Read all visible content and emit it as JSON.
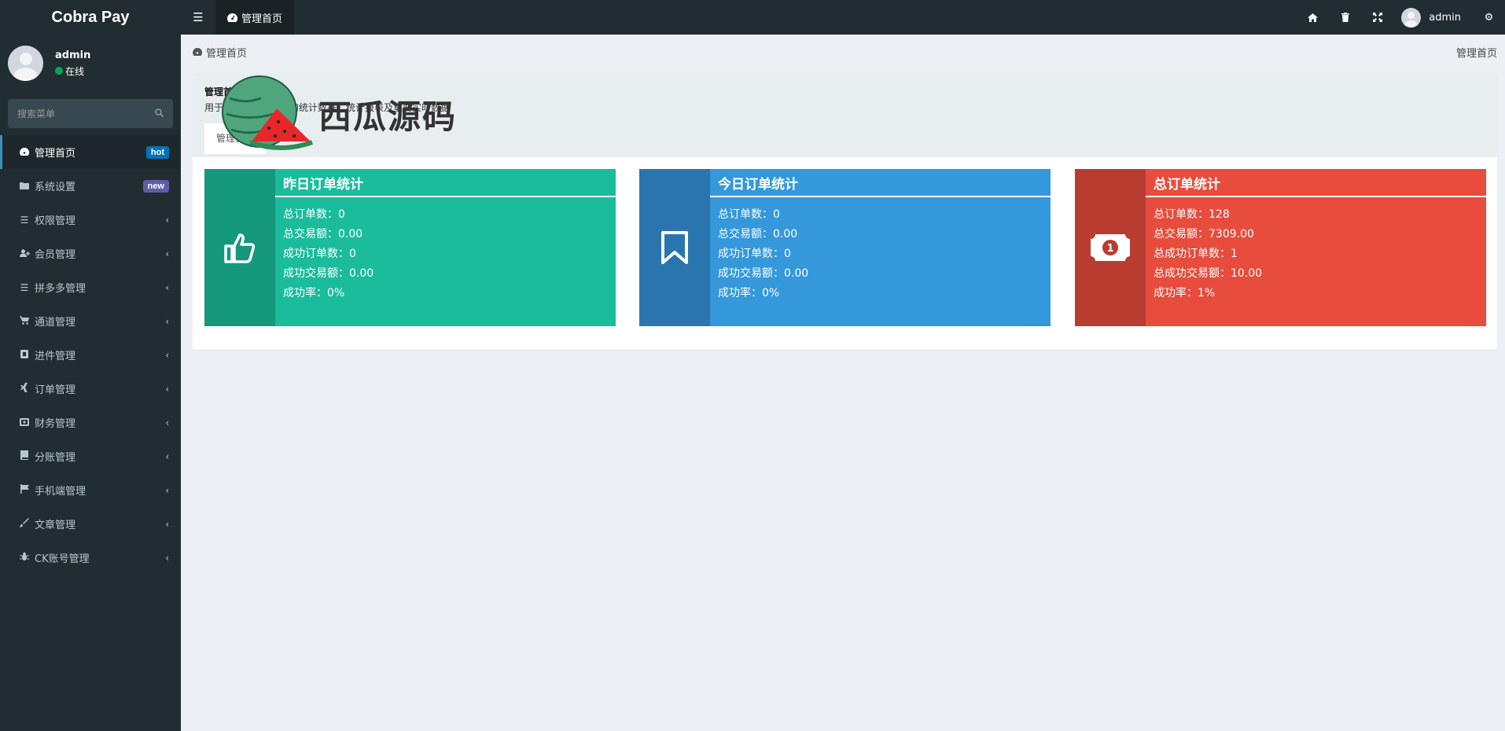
{
  "app": {
    "title": "Cobra Pay"
  },
  "navbar": {
    "toggle_icon": "bars-icon",
    "tab": {
      "icon": "dashboard-icon",
      "label": "管理首页"
    },
    "icons": [
      "home-icon",
      "trash-icon",
      "expand-icon"
    ],
    "user": {
      "name": "admin"
    },
    "settings_icon": "gears-icon"
  },
  "sidebar": {
    "user": {
      "name": "admin",
      "status": "在线"
    },
    "search": {
      "placeholder": "搜索菜单"
    },
    "items": [
      {
        "label": "管理首页",
        "icon": "dashboard-icon",
        "badge": "hot",
        "active": true
      },
      {
        "label": "系统设置",
        "icon": "folder-icon",
        "badge": "new"
      },
      {
        "label": "权限管理",
        "icon": "list-icon"
      },
      {
        "label": "会员管理",
        "icon": "user-plus-icon"
      },
      {
        "label": "拼多多管理",
        "icon": "list-icon"
      },
      {
        "label": "通道管理",
        "icon": "cart-icon"
      },
      {
        "label": "进件管理",
        "icon": "box-icon"
      },
      {
        "label": "订单管理",
        "icon": "xing-icon"
      },
      {
        "label": "财务管理",
        "icon": "wallet-icon"
      },
      {
        "label": "分账管理",
        "icon": "book-icon"
      },
      {
        "label": "手机端管理",
        "icon": "flag-icon"
      },
      {
        "label": "文章管理",
        "icon": "paint-brush-icon"
      },
      {
        "label": "CK账号管理",
        "icon": "bug-icon"
      }
    ]
  },
  "breadcrumb": {
    "left": "管理首页",
    "right": "管理首页"
  },
  "panel": {
    "title": "管理首页",
    "description": "用于展示当前系统中的统计数据、统计报表及重要实时数据",
    "tab": "管理首页"
  },
  "watermark": {
    "text": "西瓜源码"
  },
  "stats": [
    {
      "title": "昨日订单统计",
      "icon": "thumbs-up-icon",
      "color": "#1abc9c",
      "lines": [
        {
          "label": "总订单数：",
          "value": "0"
        },
        {
          "label": "总交易额：",
          "value": "0.00"
        },
        {
          "label": "成功订单数：",
          "value": "0"
        },
        {
          "label": "成功交易额：",
          "value": "0.00"
        },
        {
          "label": "成功率：",
          "value": "0%"
        }
      ]
    },
    {
      "title": "今日订单统计",
      "icon": "bookmark-icon",
      "color": "#3498db",
      "lines": [
        {
          "label": "总订单数：",
          "value": "0"
        },
        {
          "label": "总交易额：",
          "value": "0.00"
        },
        {
          "label": "成功订单数：",
          "value": "0"
        },
        {
          "label": "成功交易额：",
          "value": "0.00"
        },
        {
          "label": "成功率：",
          "value": "0%"
        }
      ]
    },
    {
      "title": "总订单统计",
      "icon": "money-icon",
      "color": "#e74c3c",
      "lines": [
        {
          "label": "总订单数：",
          "value": "128"
        },
        {
          "label": "总交易额：",
          "value": "7309.00"
        },
        {
          "label": "总成功订单数：",
          "value": "1"
        },
        {
          "label": "总成功交易额：",
          "value": "10.00"
        },
        {
          "label": "成功率：",
          "value": "1%"
        }
      ]
    }
  ]
}
